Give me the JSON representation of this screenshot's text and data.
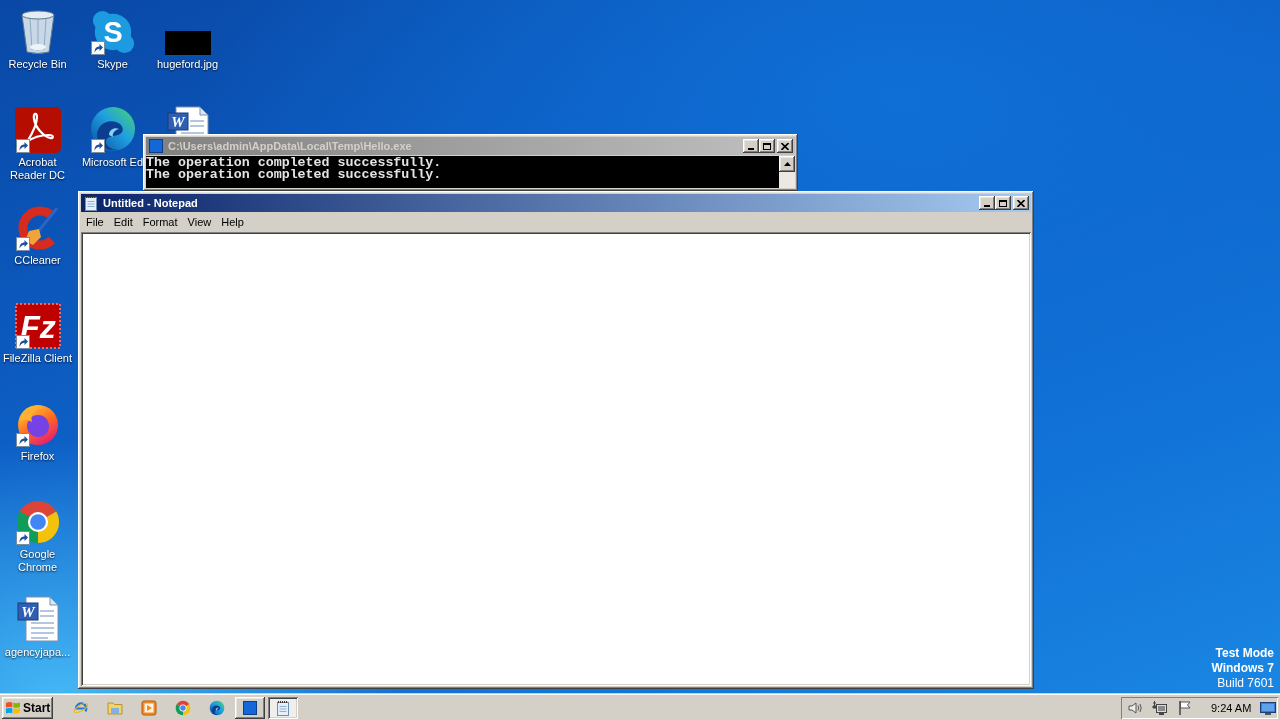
{
  "desktop_columns": [
    {
      "icons": [
        {
          "kind": "recycle-bin",
          "label": "Recycle Bin",
          "shortcut": false
        },
        {
          "kind": "acrobat",
          "label": "Acrobat Reader DC",
          "shortcut": true
        },
        {
          "kind": "ccleaner",
          "label": "CCleaner",
          "shortcut": true
        },
        {
          "kind": "filezilla",
          "label": "FileZilla Client",
          "shortcut": true,
          "glyph": "Fz"
        },
        {
          "kind": "firefox",
          "label": "Firefox",
          "shortcut": true
        },
        {
          "kind": "chrome",
          "label": "Google Chrome",
          "shortcut": true
        },
        {
          "kind": "word-document",
          "label": "agencyjapa...",
          "shortcut": false,
          "glyph": "W"
        }
      ]
    },
    {
      "icons": [
        {
          "kind": "skype",
          "label": "Skype",
          "shortcut": true,
          "glyph": "S"
        },
        {
          "kind": "edge",
          "label": "Microsoft Ed",
          "shortcut": true
        }
      ]
    },
    {
      "icons": [
        {
          "kind": "image",
          "label": "hugeford.jpg",
          "shortcut": false
        },
        {
          "kind": "word-document",
          "shortcut": false,
          "glyph": "W"
        }
      ]
    }
  ],
  "windows": [
    {
      "kind": "console",
      "title": "C:\\Users\\admin\\AppData\\Local\\Temp\\Hello.exe",
      "active": false,
      "lines": [
        "The operation completed successfully.",
        "The operation completed successfully."
      ]
    },
    {
      "kind": "notepad",
      "title": "Untitled - Notepad",
      "active": true,
      "menu": [
        "File",
        "Edit",
        "Format",
        "View",
        "Help"
      ]
    }
  ],
  "os_badge": {
    "mode": "Test Mode",
    "edition": "Windows 7",
    "build": "Build 7601"
  },
  "taskbar": {
    "start": "Start",
    "quick_launch": [
      {
        "kind": "internet-explorer"
      },
      {
        "kind": "explorer"
      },
      {
        "kind": "media-player"
      },
      {
        "kind": "chrome"
      },
      {
        "kind": "edge"
      }
    ],
    "tasks": [
      {
        "kind": "console",
        "selected": false
      },
      {
        "kind": "notepad",
        "selected": true
      }
    ],
    "tray": {
      "icons": [
        {
          "kind": "volume"
        },
        {
          "kind": "network"
        },
        {
          "kind": "action-center"
        }
      ],
      "clock": "9:24 AM"
    }
  }
}
